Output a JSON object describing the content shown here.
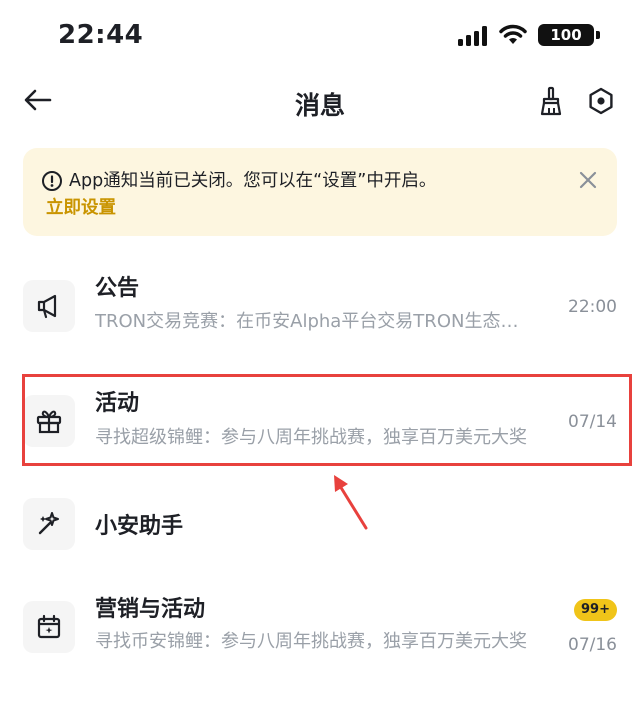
{
  "status_bar": {
    "time": "22:44",
    "battery": "100",
    "icons": [
      "signal-icon",
      "wifi-icon",
      "battery-icon"
    ]
  },
  "nav": {
    "title": "消息",
    "icons": [
      "back-arrow-icon",
      "broom-icon",
      "hexagon-settings-icon"
    ]
  },
  "notice": {
    "text": "App通知当前已关闭。您可以在“设置”中开启。",
    "link": "立即设置",
    "icons": [
      "info-icon",
      "close-icon"
    ]
  },
  "messages": [
    {
      "icon": "megaphone-icon",
      "title": "公告",
      "subtitle": "TRON交易竞赛：在币安Alpha平台交易TRON生态代币",
      "time": "22:00"
    },
    {
      "icon": "gift-icon",
      "title": "活动",
      "subtitle": "寻找超级锦鲤：参与八周年挑战赛，独享百万美元大奖",
      "time": "07/14"
    },
    {
      "icon": "sparkle-icon",
      "title": "小安助手"
    },
    {
      "icon": "calendar-icon",
      "title": "营销与活动",
      "subtitle": "寻找币安锦鲤：参与八周年挑战赛，独享百万美元大奖",
      "time": "07/16",
      "badge": "99+"
    }
  ],
  "colors": {
    "accent": "#c99400",
    "badge": "#f0c419",
    "notice_bg": "#fdf6e0",
    "highlight": "#e8413d"
  }
}
